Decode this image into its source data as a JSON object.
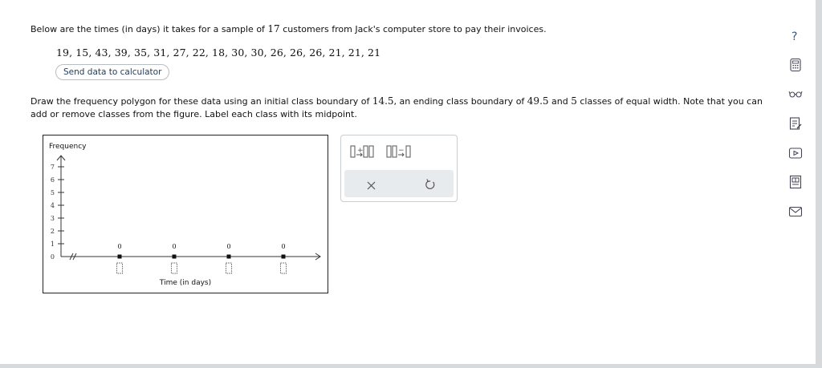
{
  "question": {
    "intro_before": "Below are the times (in days) it takes for a sample of ",
    "sample_size": "17",
    "intro_after": " customers from Jack's computer store to pay their invoices.",
    "data_values": "19, 15, 43, 39, 35, 31, 27, 22, 18, 30, 30, 26, 26, 26, 21, 21, 21",
    "send_button": "Send data to calculator",
    "instr_a": "Draw the frequency polygon for these data using an initial class boundary of ",
    "initial_boundary": "14.5",
    "instr_b": ", an ending class boundary of ",
    "ending_boundary": "49.5",
    "instr_c": " and ",
    "num_classes": "5",
    "instr_d": " classes of equal width. Note that you can add or remove classes from the figure. Label each class with its midpoint."
  },
  "graph": {
    "y_axis_label": "Frequency",
    "x_axis_label": "Time (in days)",
    "y_ticks": [
      "0",
      "1",
      "2",
      "3",
      "4",
      "5",
      "6",
      "7"
    ],
    "point_values": [
      "0",
      "0",
      "0",
      "0"
    ]
  },
  "tools": {
    "left_icon": "add-class-icon",
    "right_icon": "remove-class-icon",
    "clear_icon": "x-icon",
    "undo_icon": "undo-icon"
  },
  "sidebar": [
    "help-icon",
    "calculator-icon",
    "glasses-icon",
    "notes-icon",
    "video-icon",
    "textbook-icon",
    "mail-icon"
  ]
}
